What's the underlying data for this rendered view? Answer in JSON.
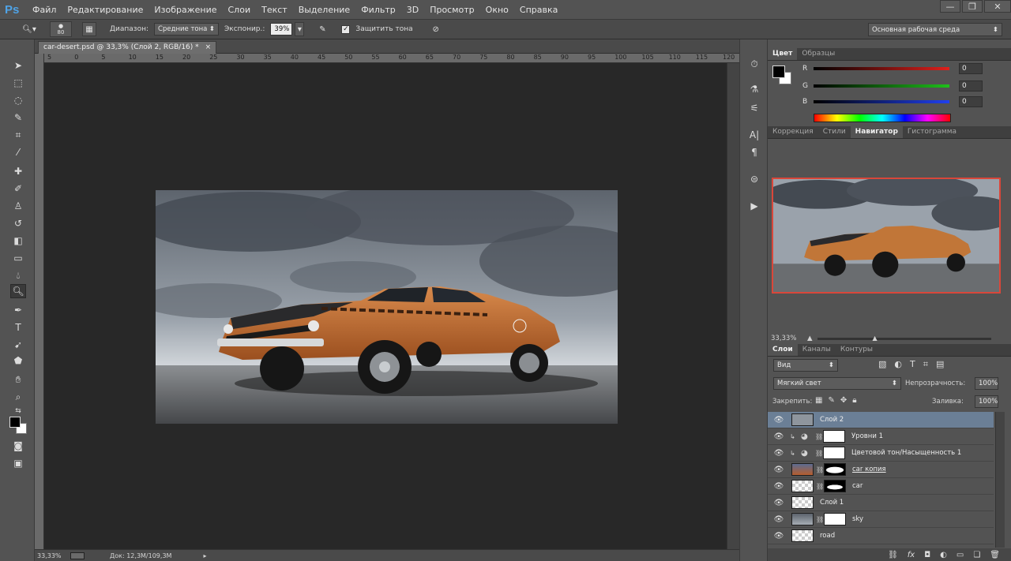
{
  "app": {
    "logo": "Ps"
  },
  "menu": [
    "Файл",
    "Редактирование",
    "Изображение",
    "Слои",
    "Текст",
    "Выделение",
    "Фильтр",
    "3D",
    "Просмотр",
    "Окно",
    "Справка"
  ],
  "window_buttons": [
    "—",
    "❐",
    "✕"
  ],
  "options": {
    "brush_size": "80",
    "range_label": "Диапазон:",
    "range_value": "Средние тона",
    "exposure_label": "Экспонир.:",
    "exposure_value": "39%",
    "protect_label": "Защитить тона",
    "workspace": "Основная рабочая среда"
  },
  "document": {
    "tab_title": "car-desert.psd @ 33,3% (Слой 2, RGB/16) *",
    "zoom": "33,33%",
    "doc_info": "Док: 12,3M/109,3M",
    "ruler_marks": [
      "5",
      "0",
      "5",
      "10",
      "15",
      "20",
      "25",
      "30",
      "35",
      "40",
      "45",
      "50",
      "55",
      "60",
      "65",
      "70",
      "75",
      "80",
      "85",
      "90",
      "95",
      "100",
      "105",
      "110",
      "115",
      "120"
    ]
  },
  "color_panel": {
    "tabs": [
      "Цвет",
      "Образцы"
    ],
    "channels": [
      {
        "label": "R",
        "value": "0",
        "color": "#e0201c"
      },
      {
        "label": "G",
        "value": "0",
        "color": "#1ec01a"
      },
      {
        "label": "B",
        "value": "0",
        "color": "#2040f0"
      }
    ]
  },
  "nav_panel": {
    "tabs": [
      "Коррекция",
      "Стили",
      "Навигатор",
      "Гистограмма"
    ],
    "zoom": "33,33%"
  },
  "layers_panel": {
    "tabs": [
      "Слои",
      "Каналы",
      "Контуры"
    ],
    "filter": "Вид",
    "blend_mode": "Мягкий свет",
    "opacity_label": "Непрозрачность:",
    "opacity": "100%",
    "lock_label": "Закрепить:",
    "fill_label": "Заливка:",
    "fill": "100%",
    "layers": [
      {
        "name": "Слой 2",
        "selected": true
      },
      {
        "name": "Уровни 1",
        "selected": false
      },
      {
        "name": "Цветовой тон/Насыщенность 1",
        "selected": false
      },
      {
        "name": "car копия",
        "selected": false
      },
      {
        "name": "car",
        "selected": false
      },
      {
        "name": "Слой 1",
        "selected": false
      },
      {
        "name": "sky",
        "selected": false
      },
      {
        "name": "road",
        "selected": false
      }
    ],
    "footer_icons": [
      "link-icon",
      "fx-icon",
      "mask-icon",
      "adjustment-icon",
      "folder-icon",
      "new-layer-icon",
      "trash-icon"
    ]
  }
}
